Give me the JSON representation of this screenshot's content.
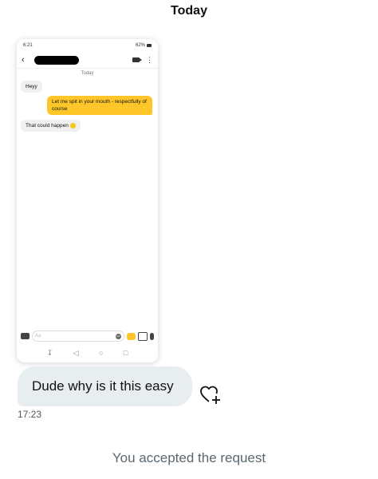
{
  "header": {
    "title": "Today"
  },
  "screenshot": {
    "status_time": "6:21",
    "status_battery": "62%",
    "day_label": "Today",
    "messages": [
      {
        "text": "Heyy",
        "from": "them"
      },
      {
        "text": "Let me spit in your mouth - respectfully of course",
        "from": "me"
      },
      {
        "text": "That could happen",
        "from": "them"
      }
    ],
    "composer_placeholder": "Aa",
    "gif_label": "GIF",
    "accent_color": "#ffc629"
  },
  "message": {
    "text": "Dude why is it this easy",
    "time": "17:23"
  },
  "notice": "You accepted the request"
}
